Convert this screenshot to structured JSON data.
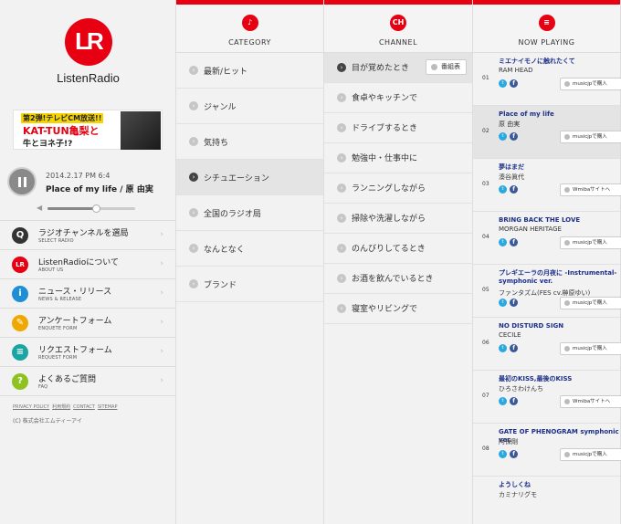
{
  "logo": {
    "mark": "LR",
    "name": "ListenRadio"
  },
  "banner": {
    "line1": "第2弾!テレビCM放送!!",
    "line2": "KAT-TUN亀梨と",
    "line3": "牛とヨネ子!?"
  },
  "player": {
    "timestamp": "2014.2.17 PM 6:4",
    "song": "Place of my life / 原 由実",
    "volume_fraction": 0.55
  },
  "menu": [
    {
      "label": "ラジオチャンネルを選局",
      "sub": "SELECT RADIO",
      "icon": "search-icon",
      "color": "#333333",
      "glyph": "Q"
    },
    {
      "label": "ListenRadioについて",
      "sub": "ABOUT US",
      "icon": "lr-logo-icon",
      "color": "#e60012",
      "glyph": "LR"
    },
    {
      "label": "ニュース・リリース",
      "sub": "NEWS & RELEASE",
      "icon": "info-icon",
      "color": "#1e8fd6",
      "glyph": "i"
    },
    {
      "label": "アンケートフォーム",
      "sub": "ENQUETE FORM",
      "icon": "pencil-icon",
      "color": "#f0a800",
      "glyph": "✎"
    },
    {
      "label": "リクエストフォーム",
      "sub": "REQUEST FORM",
      "icon": "chat-icon",
      "color": "#1aa5a5",
      "glyph": "≡"
    },
    {
      "label": "よくあるご質問",
      "sub": "FAQ",
      "icon": "question-icon",
      "color": "#8dc21f",
      "glyph": "?"
    }
  ],
  "footer": {
    "links": [
      "PRIVACY POLICY",
      "利用規約",
      "CONTACT",
      "SITEMAP"
    ],
    "copyright": "(C) 株式会社エムティーアイ"
  },
  "columns": {
    "category": {
      "title": "CATEGORY",
      "icon": "music-note-icon",
      "glyph": "♪"
    },
    "channel": {
      "title": "CHANNEL",
      "icon": "ch-icon",
      "glyph": "CH"
    },
    "playing": {
      "title": "NOW PLAYING",
      "icon": "list-icon",
      "glyph": "≡"
    }
  },
  "categories": [
    "最新/ヒット",
    "ジャンル",
    "気持ち",
    "シチュエーション",
    "全国のラジオ局",
    "なんとなく",
    "ブランド"
  ],
  "selected_category": 3,
  "channels": [
    "目が覚めたとき",
    "食卓やキッチンで",
    "ドライブするとき",
    "勉強中・仕事中に",
    "ランニングしながら",
    "掃除や洗濯しながら",
    "のんびりしてるとき",
    "お酒を飲んでいるとき",
    "寝室やリビングで"
  ],
  "selected_channel": 0,
  "program_button": "番組表",
  "now_playing": [
    {
      "num": "01",
      "title": "ミエナイモノに触れたくて",
      "artist": "RAM HEAD",
      "buy": "musicjpで購入"
    },
    {
      "num": "02",
      "title": "Place of my life",
      "artist": "原 由実",
      "buy": "musicjpで購入"
    },
    {
      "num": "03",
      "title": "夢はまだ",
      "artist": "湊谷眞代",
      "buy": "Wmibaサイトへ"
    },
    {
      "num": "04",
      "title": "BRING BACK THE LOVE",
      "artist": "MORGAN HERITAGE",
      "buy": "musicjpで購入"
    },
    {
      "num": "05",
      "title": "プレギエーラの月夜に -Instrumental- symphonic ver.",
      "artist": "ファンタズム(FES cv.榊原ゆい)",
      "buy": "musicjpで購入"
    },
    {
      "num": "06",
      "title": "NO DISTURD SIGN",
      "artist": "CECILE",
      "buy": "musicjpで購入"
    },
    {
      "num": "07",
      "title": "最初のKISS,最後のKISS",
      "artist": "ひろさわけんち",
      "buy": "Wmibaサイトへ"
    },
    {
      "num": "08",
      "title": "GATE OF PHENOGRAM symphonic ver.",
      "artist": "阿保剛",
      "buy": "musicjpで購入"
    },
    {
      "num": "",
      "title": "ようしくね",
      "artist": "カミナリグモ",
      "buy": ""
    }
  ],
  "selected_track": 1
}
